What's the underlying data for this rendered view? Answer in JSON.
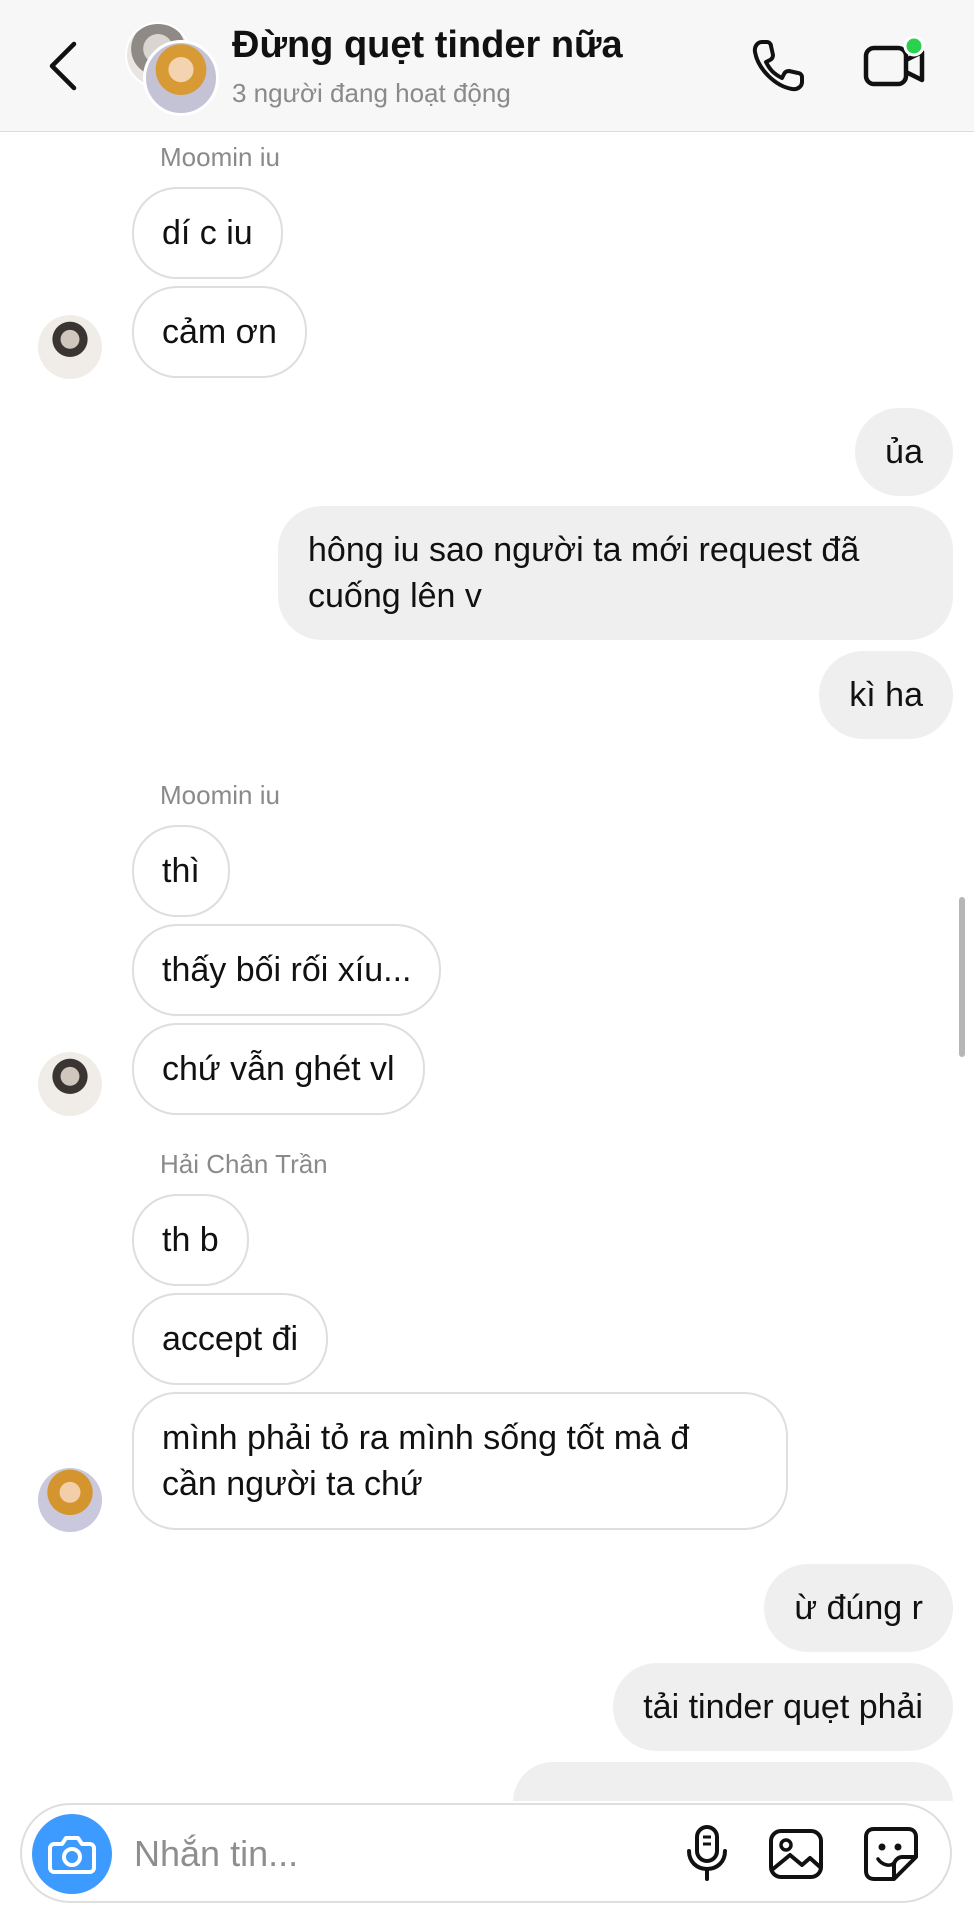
{
  "header": {
    "title": "Đừng quẹt tinder nữa",
    "subtitle": "3 người đang hoạt động"
  },
  "messages": {
    "g1_sender": "Moomin iu",
    "m1": "dí c iu",
    "m2": "cảm ơn",
    "m3": "ủa",
    "m4": "hông iu sao người ta mới request đã cuống lên v",
    "m5": "kì ha",
    "g2_sender": "Moomin iu",
    "m6": "thì",
    "m7": "thấy bối rối xíu...",
    "m8": "chứ vẫn ghét vl",
    "g3_sender": "Hải Chân Trần",
    "m9": "th b",
    "m10": "accept đi",
    "m11": "mình phải tỏ ra mình sống tốt mà đ cần người ta chứ",
    "m12": "ừ đúng r",
    "m13": "tải tinder quẹt phải"
  },
  "composer": {
    "placeholder": "Nhắn tin..."
  },
  "icons": {
    "back": "chevron-left-icon",
    "call": "phone-icon",
    "video": "video-camera-icon",
    "camera": "camera-icon",
    "mic": "microphone-icon",
    "gallery": "image-icon",
    "sticker": "sticker-icon"
  },
  "colors": {
    "accent": "#3d9bff",
    "active_dot": "#2bd04f",
    "outgoing_bubble": "#efefef"
  }
}
